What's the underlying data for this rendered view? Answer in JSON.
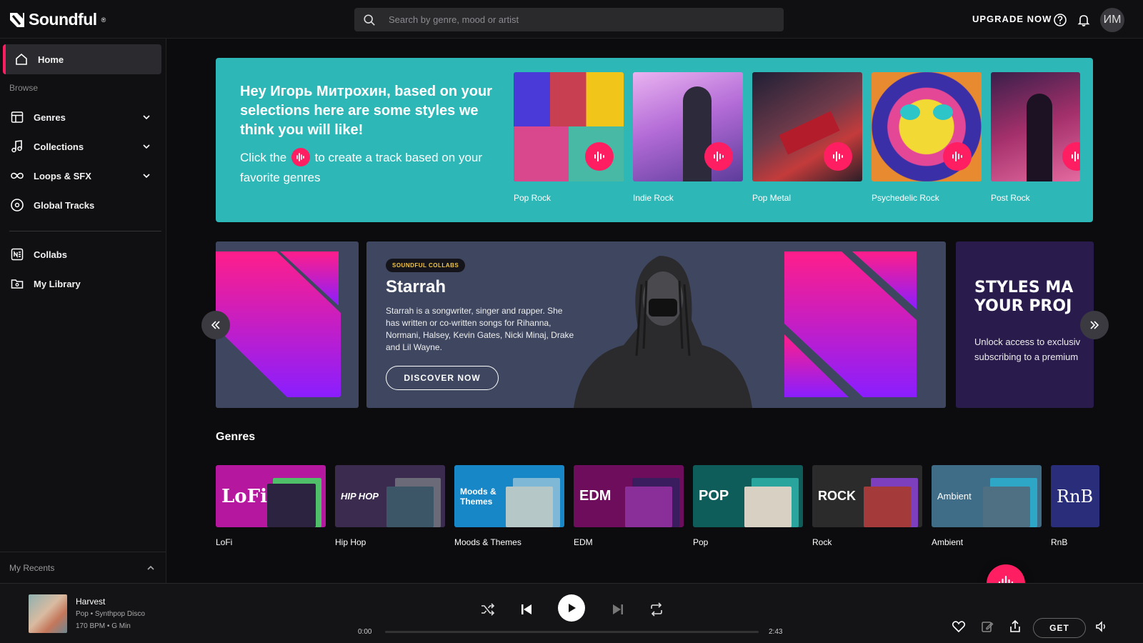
{
  "app": {
    "name": "Soundful",
    "trademark": "®",
    "brand_color": "#ff1e62",
    "teal": "#2db8b7"
  },
  "header": {
    "search_placeholder": "Search by genre, mood or artist",
    "upgrade_label": "UPGRADE NOW",
    "avatar_initials": "ИМ"
  },
  "sidebar": {
    "home": "Home",
    "browse_label": "Browse",
    "items": [
      {
        "label": "Genres",
        "icon": "table-icon",
        "expandable": true
      },
      {
        "label": "Collections",
        "icon": "music-note-icon",
        "expandable": true
      },
      {
        "label": "Loops & SFX",
        "icon": "infinity-icon",
        "expandable": true
      },
      {
        "label": "Global Tracks",
        "icon": "disc-icon",
        "expandable": false
      }
    ],
    "collabs": "Collabs",
    "library": "My Library",
    "recents": "My Recents"
  },
  "recommendation": {
    "title": "Hey Игорь Митрохин, based on your selections here are some styles we think you will like!",
    "sub_before": "Click the",
    "sub_after": "to create a track based on your favorite genres",
    "styles": [
      "Pop Rock",
      "Indie Rock",
      "Pop Metal",
      "Psychedelic Rock",
      "Post Rock"
    ]
  },
  "hero": {
    "badge": "SOUNDFUL COLLABS",
    "name": "Starrah",
    "description": "Starrah is a songwriter, singer and rapper. She has written or co-written songs for Rihanna, Normani, Halsey, Kevin Gates, Nicki Minaj, Drake and Lil Wayne.",
    "cta": "DISCOVER NOW",
    "promo_title": "STYLES MA YOUR PROJ",
    "promo_line1": "STYLES MA",
    "promo_line2": "YOUR PROJ",
    "promo_desc1": "Unlock access to exclusiv",
    "promo_desc2": "subscribing to a premium"
  },
  "genres": {
    "title": "Genres",
    "items": [
      {
        "name": "LoFi",
        "art_label": "LoFi",
        "color": "#b5179e"
      },
      {
        "name": "Hip Hop",
        "art_label": "HIP HOP",
        "color": "#3b2c4f"
      },
      {
        "name": "Moods & Themes",
        "art_label": "Moods & Themes",
        "color": "#1887c8"
      },
      {
        "name": "EDM",
        "art_label": "EDM",
        "color": "#6e0d5c"
      },
      {
        "name": "Pop",
        "art_label": "POP",
        "color": "#0f5d5a"
      },
      {
        "name": "Rock",
        "art_label": "ROCK",
        "color": "#2b2b2b"
      },
      {
        "name": "Ambient",
        "art_label": "Ambient",
        "color": "#3f6c86"
      },
      {
        "name": "RnB",
        "art_label": "RnB",
        "color": "#2a2e7a"
      }
    ]
  },
  "player": {
    "title": "Harvest",
    "genre_line": "Pop • Synthpop Disco",
    "bpm_line": "170 BPM • G Min",
    "time_current": "0:00",
    "time_total": "2:43",
    "progress": 0,
    "get_label": "GET"
  }
}
